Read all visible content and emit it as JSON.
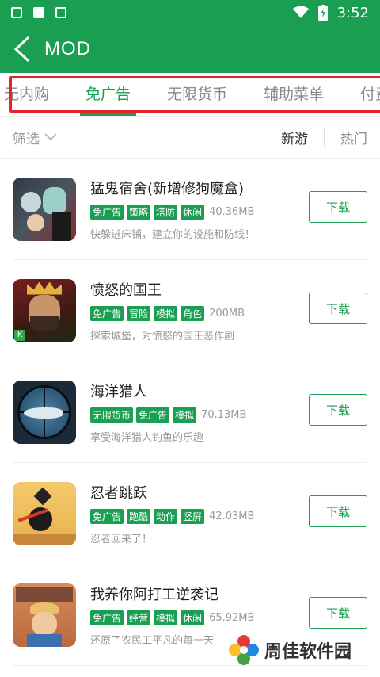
{
  "status_bar": {
    "time": "3:52",
    "icons": [
      "lock-icon",
      "book-icon",
      "text-icon",
      "wifi-icon",
      "battery-icon"
    ]
  },
  "app_bar": {
    "title": "MOD"
  },
  "tabs": [
    {
      "label": "无内购"
    },
    {
      "label": "免广告",
      "active": true
    },
    {
      "label": "无限货币"
    },
    {
      "label": "辅助菜单"
    },
    {
      "label": "付费"
    }
  ],
  "filter": {
    "label": "筛选"
  },
  "sort": {
    "new": "新游",
    "hot": "热门"
  },
  "apps": [
    {
      "name": "猛鬼宿舍(新增修狗魔盒)",
      "tags": [
        "免广告",
        "策略",
        "塔防",
        "休闲"
      ],
      "size": "40.36MB",
      "desc": "快躲进床铺，建立你的设施和防线！",
      "button": "下载"
    },
    {
      "name": "愤怒的国王",
      "tags": [
        "免广告",
        "冒险",
        "模拟",
        "角色"
      ],
      "size": "200MB",
      "desc": "探索城堡，对愤怒的国王恶作剧",
      "button": "下载"
    },
    {
      "name": "海洋猎人",
      "tags": [
        "无限货币",
        "免广告",
        "模拟"
      ],
      "size": "70.13MB",
      "desc": "享受海洋猎人钓鱼的乐趣",
      "button": "下载"
    },
    {
      "name": "忍者跳跃",
      "tags": [
        "免广告",
        "跑酷",
        "动作",
        "竖屏"
      ],
      "size": "42.03MB",
      "desc": "忍者回来了！",
      "button": "下载"
    },
    {
      "name": "我养你阿打工逆袭记",
      "tags": [
        "免广告",
        "经营",
        "模拟",
        "休闲"
      ],
      "size": "65.92MB",
      "desc": "还原了农民工平凡的每一天",
      "button": "下载"
    }
  ],
  "watermark": {
    "text": "周佳软件园"
  },
  "colors": {
    "primary": "#1a9f52",
    "highlight": "#e5232b"
  }
}
